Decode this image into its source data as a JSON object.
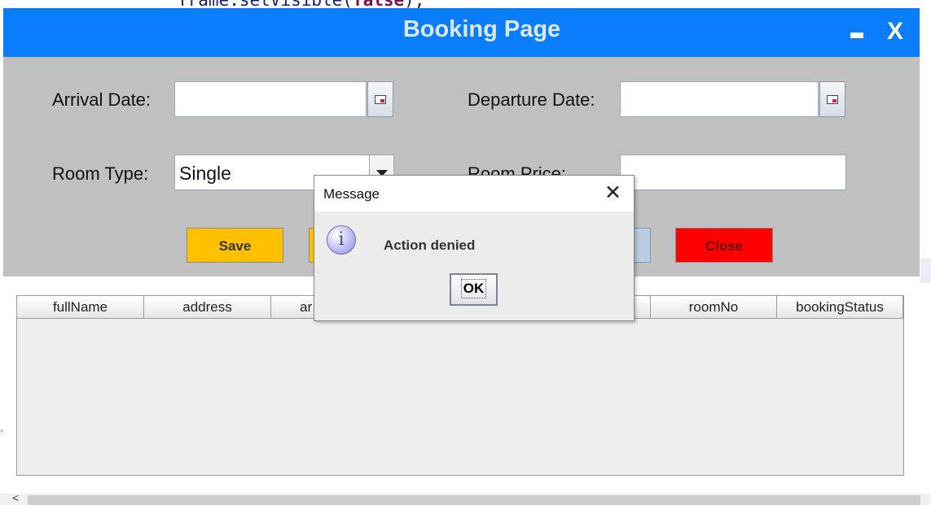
{
  "background": {
    "code_line_prefix": "frame.setVisible(",
    "code_line_keyword": "false",
    "code_line_suffix": ");"
  },
  "window": {
    "title": "Booking Page",
    "minimize_label": "-",
    "close_label": "X",
    "title_color": "#0a7dfd"
  },
  "form": {
    "arrival_label": "Arrival Date:",
    "arrival_value": "",
    "departure_label": "Departure Date:",
    "departure_value": "",
    "room_type_label": "Room Type:",
    "room_type_value": "Single",
    "room_price_label": "Room Price:",
    "room_price_value": ""
  },
  "actions": {
    "save_label": "Save",
    "close_label": "Close",
    "save_color": "#ffc000",
    "close_color": "#ff0000"
  },
  "table": {
    "columns": [
      "fullName",
      "address",
      "ar",
      "",
      "",
      "roomNo",
      "bookingStatus"
    ]
  },
  "dialog": {
    "title": "Message",
    "close_glyph": "✕",
    "icon": "info-icon",
    "message": "Action denied",
    "ok_label": "OK"
  }
}
